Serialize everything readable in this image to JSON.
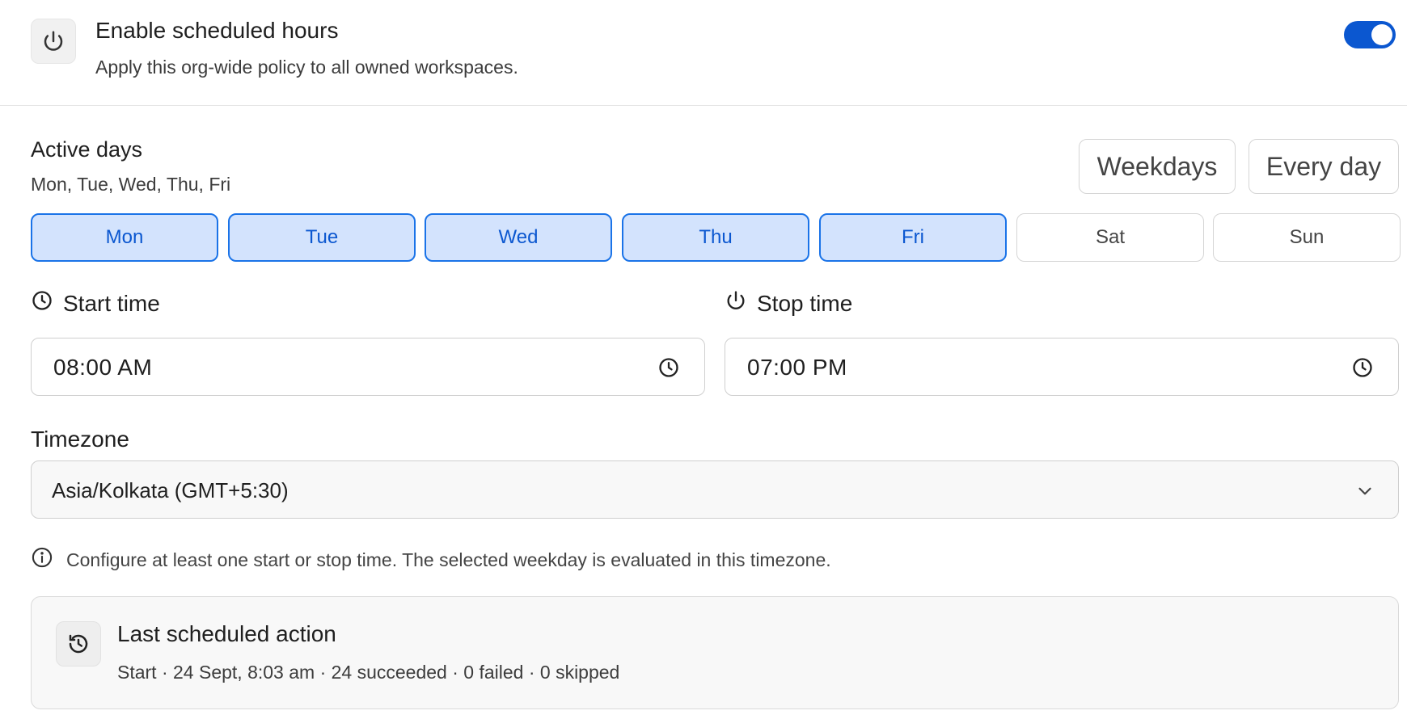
{
  "schedule": {
    "enable_title": "Enable scheduled hours",
    "enable_description": "Apply this org-wide policy to all owned workspaces.",
    "enabled": true,
    "accent_color": "#0b57d0"
  },
  "active_days": {
    "title": "Active days",
    "summary": "Mon, Tue, Wed, Thu, Fri",
    "presets": [
      "Weekdays",
      "Every day"
    ],
    "days": [
      {
        "label": "Mon",
        "selected": true
      },
      {
        "label": "Tue",
        "selected": true
      },
      {
        "label": "Wed",
        "selected": true
      },
      {
        "label": "Thu",
        "selected": true
      },
      {
        "label": "Fri",
        "selected": true
      },
      {
        "label": "Sat",
        "selected": false
      },
      {
        "label": "Sun",
        "selected": false
      }
    ]
  },
  "start_time": {
    "label": "Start time",
    "value": "08:00 AM",
    "icon": "clock-icon"
  },
  "stop_time": {
    "label": "Stop time",
    "value": "07:00 PM",
    "icon": "power-icon"
  },
  "timezone": {
    "label": "Timezone",
    "value": "Asia/Kolkata (GMT+5:30)"
  },
  "note": {
    "text": "Configure at least one start or stop time. The selected weekday is evaluated in this timezone.",
    "icon": "info-icon"
  },
  "last_action": {
    "title": "Last scheduled action",
    "detail": "Start · 24 Sept, 8:03 am · 24 succeeded · 0 failed · 0 skipped",
    "icon": "history-icon"
  }
}
